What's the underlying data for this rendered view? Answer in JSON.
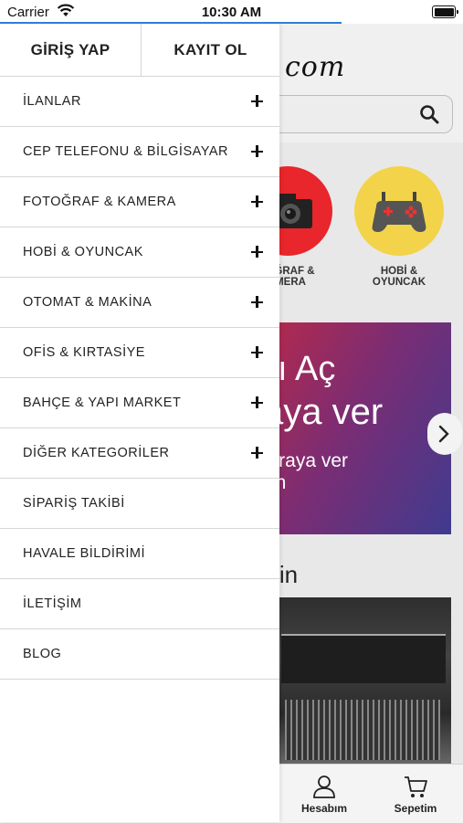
{
  "status_bar": {
    "carrier": "Carrier",
    "time": "10:30 AM"
  },
  "drawer": {
    "login_label": "GİRİŞ YAP",
    "register_label": "KAYIT OL",
    "items": [
      {
        "label": "İLANLAR",
        "expandable": true
      },
      {
        "label": "CEP TELEFONU & BİLGİSAYAR",
        "expandable": true
      },
      {
        "label": "FOTOĞRAF & KAMERA",
        "expandable": true
      },
      {
        "label": "HOBİ & OYUNCAK",
        "expandable": true
      },
      {
        "label": "OTOMAT & MAKİNA",
        "expandable": true
      },
      {
        "label": "OFİS & KIRTASİYE",
        "expandable": true
      },
      {
        "label": "BAHÇE & YAPI MARKET",
        "expandable": true
      },
      {
        "label": "DİĞER KATEGORİLER",
        "expandable": true
      },
      {
        "label": "SİPARİŞ TAKİBİ",
        "expandable": false
      },
      {
        "label": "HAVALE BİLDİRİMİ",
        "expandable": false
      },
      {
        "label": "İLETİŞİM",
        "expandable": false
      },
      {
        "label": "BLOG",
        "expandable": false
      }
    ]
  },
  "background": {
    "logo_fragment": "com",
    "categories": [
      {
        "label_line1": "OĞRAF &",
        "label_line2": "MERA",
        "icon": "camera-icon",
        "color": "#e8262b"
      },
      {
        "label_line1": "HOBİ &",
        "label_line2": "OYUNCAK",
        "icon": "gamepad-icon",
        "color": "#f3d349"
      }
    ],
    "banner": {
      "line1": "ı Aç",
      "line2": "aya ver",
      "line3": "kiraya ver",
      "line4": "an"
    },
    "section_title": "trin",
    "tabs": {
      "account_label": "Hesabım",
      "cart_label": "Sepetim"
    }
  },
  "colors": {
    "accent_loading": "#2f7dd8",
    "divider": "#d6d6d6"
  }
}
